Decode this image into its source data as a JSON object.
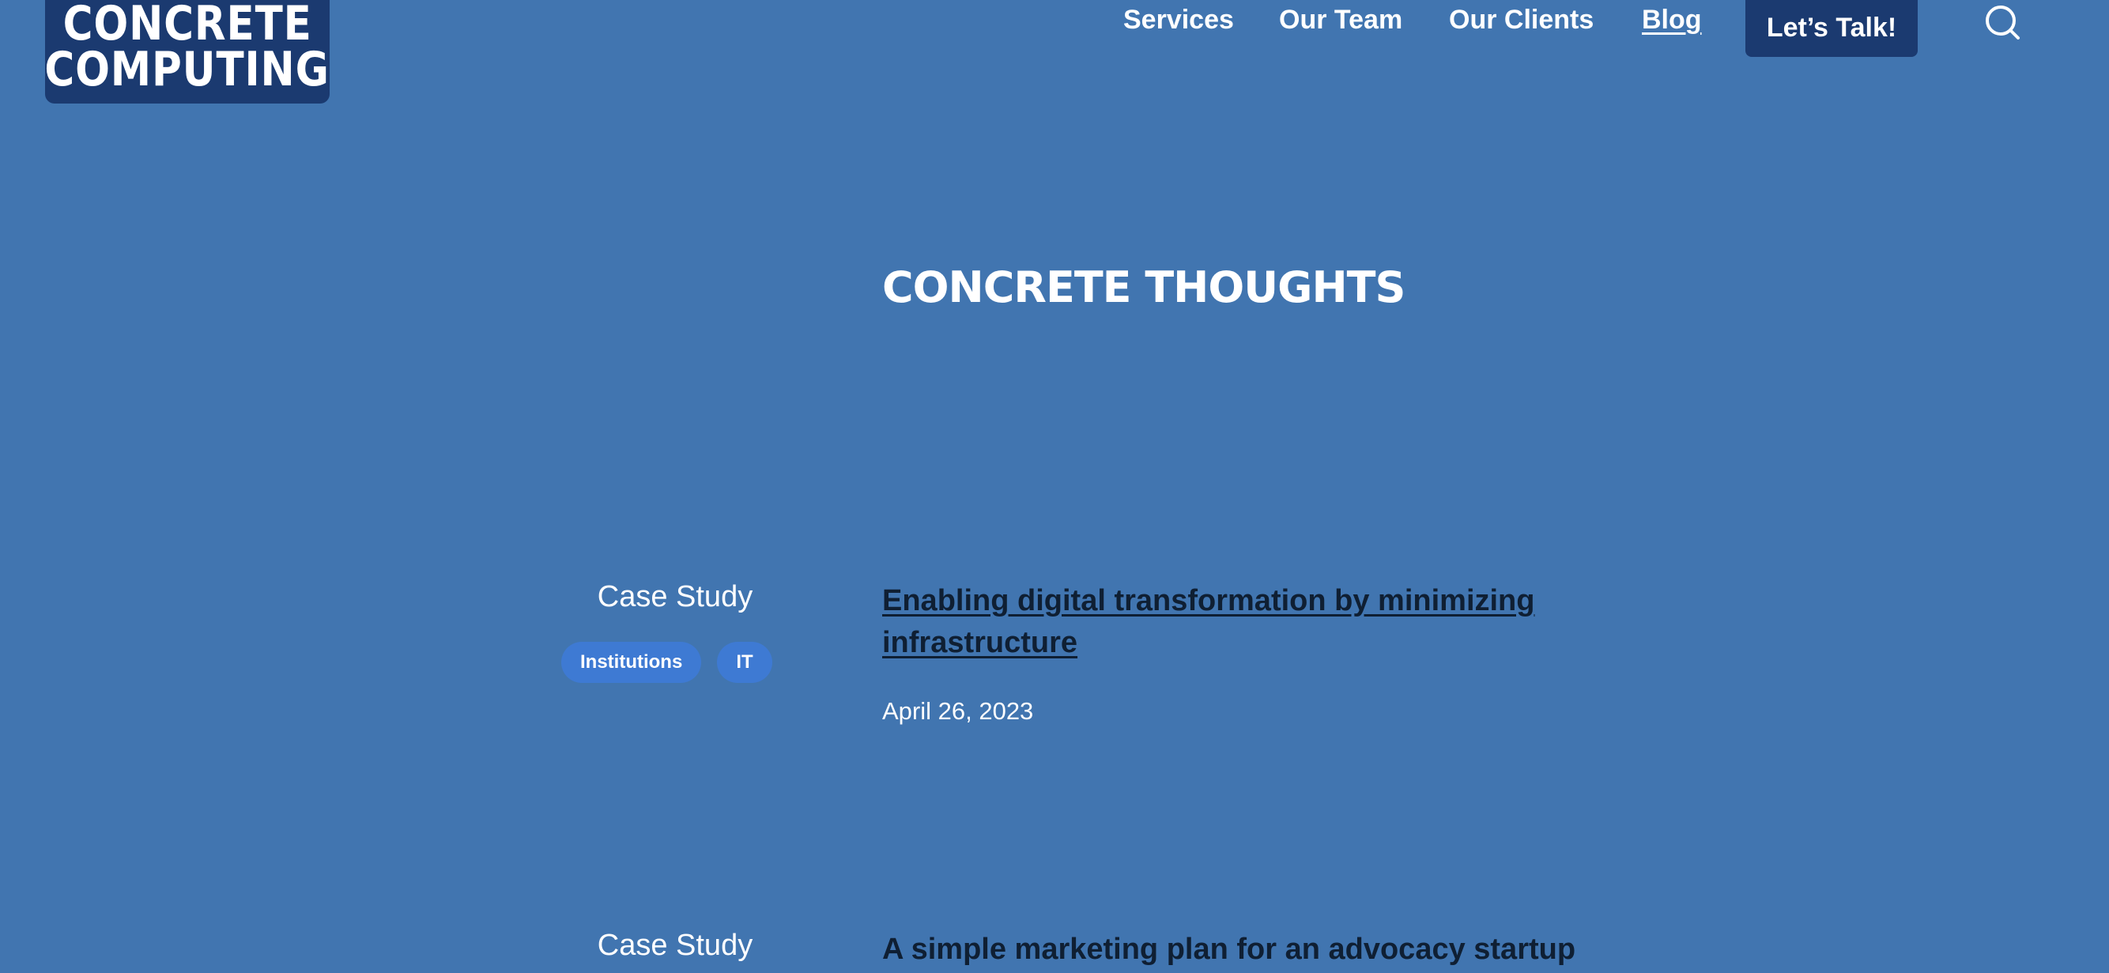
{
  "logo": {
    "line1": "CONCRETE",
    "line2": "COMPUTING"
  },
  "nav": {
    "items": [
      {
        "label": "Services"
      },
      {
        "label": "Our Team"
      },
      {
        "label": "Our Clients"
      },
      {
        "label": "Blog"
      }
    ],
    "cta_label": "Let’s Talk!",
    "search_icon": "search-icon"
  },
  "heading": "CONCRETE THOUGHTS",
  "posts": [
    {
      "category": "Case Study",
      "tags": [
        "Institutions",
        "IT"
      ],
      "title": "Enabling digital transformation by minimizing infrastructure",
      "date": "April 26, 2023"
    },
    {
      "category": "Case Study",
      "title": "A simple marketing plan for an advocacy startup"
    }
  ],
  "colors": {
    "background": "#4175b0",
    "brand_dark": "#1b3a70",
    "tag": "#3e7ad3",
    "title_text": "#0f1f33"
  }
}
